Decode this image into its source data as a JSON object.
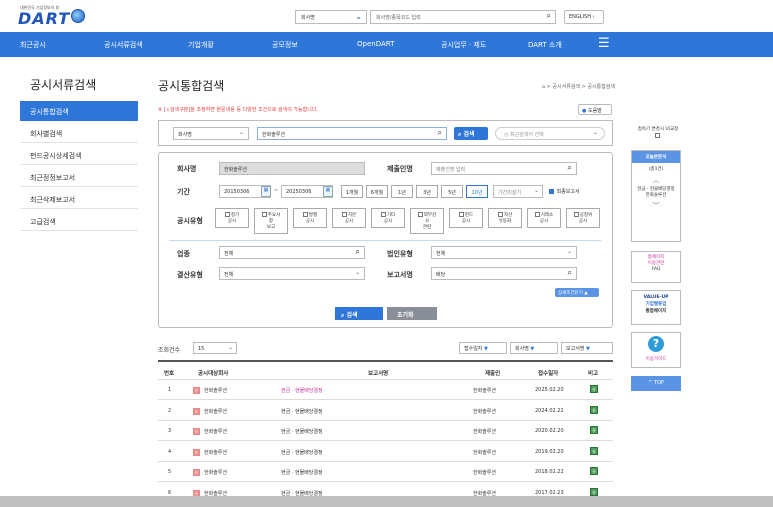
{
  "header": {
    "logo_sub": "대한민국 기업정보의 창",
    "logo_text": "DART",
    "search_select": "회사명",
    "search_placeholder": "회사명/종목코드 입력",
    "english_label": "ENGLISH"
  },
  "nav": {
    "items": [
      "최근공시",
      "공시서류검색",
      "기업개황",
      "공모정보",
      "OpenDART",
      "공시업무 · 제도",
      "DART 소개"
    ]
  },
  "sidebar": {
    "title": "공시서류검색",
    "items": [
      {
        "label": "공시통합검색",
        "active": true
      },
      {
        "label": "회사별검색",
        "active": false
      },
      {
        "label": "펀드공시상세검색",
        "active": false
      },
      {
        "label": "최근정정보고서",
        "active": false
      },
      {
        "label": "최근삭제보고서",
        "active": false
      },
      {
        "label": "고급검색",
        "active": false
      }
    ]
  },
  "main": {
    "title": "공시통합검색",
    "breadcrumb": "> 공시서류검색 > 공시통합검색",
    "note": "※ [↓검색구분]을 조정하면 본문내용 등 다양한 조건으로 검색이 가능합니다.",
    "help_label": "도움말",
    "search": {
      "type_select": "회사명",
      "query": "한화솔루션",
      "search_label": "검색",
      "recent_placeholder": "최근검색어 선택"
    },
    "form": {
      "company_label": "회사명",
      "company_value": "한화솔루션",
      "submitter_label": "제출인명",
      "submitter_placeholder": "제출인명 입력",
      "period_label": "기간",
      "start_date": "20150306",
      "end_date": "20250306",
      "period_buttons": [
        "1개월",
        "6개월",
        "1년",
        "3년",
        "5년",
        "10년"
      ],
      "period_active": "10년",
      "period_select": "기간미설기",
      "final_report_label": "최종보고서",
      "type_label": "공시유형",
      "types": [
        [
          "정기",
          "공시"
        ],
        [
          "주요사",
          "항"
        ],
        [
          "발행",
          "공시"
        ],
        [
          "지분",
          "공시"
        ],
        [
          "기타",
          "공시"
        ],
        [
          "외부감",
          "사"
        ],
        [
          "펀드",
          "공시"
        ],
        [
          "자산",
          "유동화"
        ],
        [
          "거래소",
          "공시"
        ],
        [
          "공정위",
          "공시"
        ]
      ],
      "types_sub": [
        "보고",
        "관련"
      ],
      "industry_label": "업종",
      "industry_value": "전체",
      "corp_type_label": "법인유형",
      "corp_type_value": "전체",
      "settle_label": "결산유형",
      "settle_value": "전체",
      "report_name_label": "보고서명",
      "report_name_value": "배당",
      "detail_toggle": "상세조건닫기 ▲",
      "search_label": "검색",
      "reset_label": "초기화"
    },
    "results": {
      "count_label": "조회건수",
      "count_value": "15",
      "sort_options": [
        "접수일자",
        "회사명",
        "보고서명"
      ],
      "columns": [
        "번호",
        "공시대상회사",
        "보고서명",
        "제출인",
        "접수일자",
        "비고"
      ],
      "rows": [
        {
          "no": "1",
          "company": "한화솔루션",
          "report": "현금 · 현물배당결정",
          "submitter": "한화솔루션",
          "date": "2025.02.20",
          "note": "유",
          "highlight": true
        },
        {
          "no": "2",
          "company": "한화솔루션",
          "report": "현금 · 현물배당결정",
          "submitter": "한화솔루션",
          "date": "2024.02.22",
          "note": "유",
          "highlight": false
        },
        {
          "no": "3",
          "company": "한화솔루션",
          "report": "현금 · 현물배당결정",
          "submitter": "한화솔루션",
          "date": "2020.02.20",
          "note": "유",
          "highlight": false
        },
        {
          "no": "4",
          "company": "한화솔루션",
          "report": "현금 · 현물배당결정",
          "submitter": "한화솔루션",
          "date": "2019.02.20",
          "note": "유",
          "highlight": false
        },
        {
          "no": "5",
          "company": "한화솔루션",
          "report": "현금 · 현물배당결정",
          "submitter": "한화솔루션",
          "date": "2018.02.22",
          "note": "유",
          "highlight": false
        },
        {
          "no": "6",
          "company": "한화솔루션",
          "report": "현금 · 현물배당결정",
          "submitter": "한화솔루션",
          "date": "2017.02.23",
          "note": "유",
          "highlight": false
        }
      ]
    }
  },
  "right_panel": {
    "notice_label": "접속기 변경시 UI교정",
    "recent_title": "오늘본문서",
    "recent_count": "(총1건)",
    "recent_item": "현금 · 현물배당결정 한화솔루션",
    "faq_line1": "홈페이지",
    "faq_line2": "이용관련",
    "faq_line3": "FAQ",
    "value_up": "VALUE-UP",
    "value_up2": "기업밸류업",
    "value_up3": "통합페이지",
    "guide_label": "이용가이드",
    "top_label": "TOP"
  },
  "colors": {
    "accent": "#2f76d9",
    "link": "#c0399c",
    "note_red": "#e23b3b"
  }
}
